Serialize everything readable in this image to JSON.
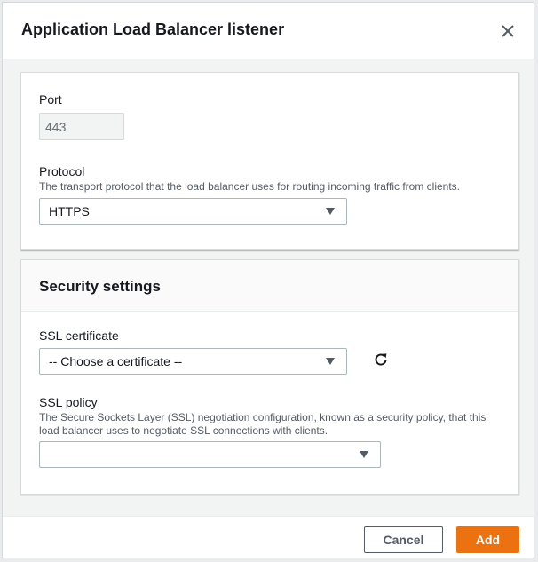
{
  "modal": {
    "title": "Application Load Balancer listener",
    "close_icon": "close-icon"
  },
  "listener": {
    "port_label": "Port",
    "port_value": "443",
    "protocol_label": "Protocol",
    "protocol_description": "The transport protocol that the load balancer uses for routing incoming traffic from clients.",
    "protocol_value": "HTTPS"
  },
  "security": {
    "title": "Security settings",
    "ssl_certificate_label": "SSL certificate",
    "ssl_certificate_value": "-- Choose a certificate --",
    "refresh_icon": "refresh-icon",
    "ssl_policy_label": "SSL policy",
    "ssl_policy_description_line1": "The Secure Sockets Layer (SSL) negotiation configuration, known as a security policy, that this",
    "ssl_policy_description_line2": "load balancer uses to negotiate SSL connections with clients.",
    "ssl_policy_value": ""
  },
  "footer": {
    "cancel_label": "Cancel",
    "add_label": "Add"
  },
  "colors": {
    "primary_button": "#ec7211",
    "text": "#16191f",
    "muted_text": "#545b64"
  }
}
